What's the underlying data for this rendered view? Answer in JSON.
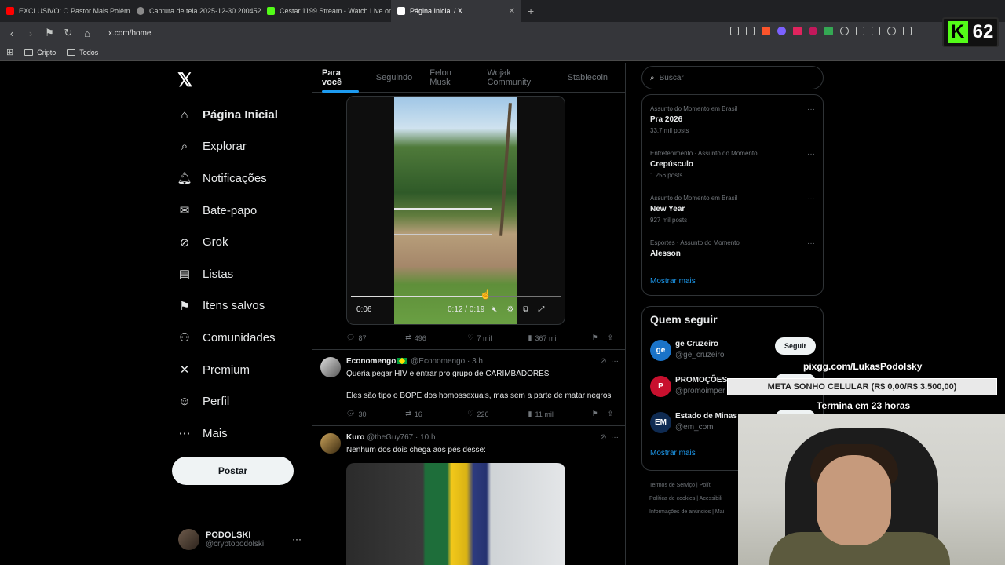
{
  "browser": {
    "tabs": [
      {
        "title": "EXCLUSIVO: O Pastor Mais Polêmico",
        "fav_color": "#ff0000",
        "active": false
      },
      {
        "title": "Captura de tela 2025-12-30 200452...",
        "fav_color": "#8a8a8a",
        "active": false
      },
      {
        "title": "Cestari1199 Stream - Watch Live on ...",
        "fav_color": "#53fc18",
        "active": false
      },
      {
        "title": "Página Inicial / X",
        "fav_color": "#ffffff",
        "active": true
      }
    ],
    "new_tab": "+",
    "close": "✕",
    "url": "x.com/home",
    "bookmarks": [
      "Cripto",
      "Todos"
    ]
  },
  "overlay_kick": {
    "logo": "K",
    "count": "62"
  },
  "x": {
    "logo": "𝕏",
    "nav": [
      {
        "label": "Página Inicial",
        "icon": "home-icon",
        "glyph": "⌂",
        "active": true
      },
      {
        "label": "Explorar",
        "icon": "search-icon",
        "glyph": "⌕"
      },
      {
        "label": "Notificações",
        "icon": "bell-icon",
        "glyph": "🔔︎"
      },
      {
        "label": "Bate-papo",
        "icon": "mail-icon",
        "glyph": "✉"
      },
      {
        "label": "Grok",
        "icon": "grok-icon",
        "glyph": "⊘"
      },
      {
        "label": "Listas",
        "icon": "list-icon",
        "glyph": "▤"
      },
      {
        "label": "Itens salvos",
        "icon": "bookmark-icon",
        "glyph": "⚑"
      },
      {
        "label": "Comunidades",
        "icon": "communities-icon",
        "glyph": "⚇"
      },
      {
        "label": "Premium",
        "icon": "x-premium-icon",
        "glyph": "✕"
      },
      {
        "label": "Perfil",
        "icon": "person-icon",
        "glyph": "☺"
      },
      {
        "label": "Mais",
        "icon": "more-circle-icon",
        "glyph": "⋯"
      }
    ],
    "post_button": "Postar",
    "account": {
      "name": "PODOLSKI",
      "handle": "@cryptopodolski",
      "more": "···"
    }
  },
  "feed": {
    "tabs": [
      "Para você",
      "Seguindo",
      "Felon Musk",
      "Wojak Community",
      "Stablecoin"
    ],
    "video": {
      "time_left": "0:06",
      "time": "0:12 / 0:19",
      "progress": 0.63
    },
    "post1_actions": {
      "replies": "87",
      "reposts": "496",
      "likes": "7 mil",
      "views": "367 mil"
    },
    "post2": {
      "name": "Economengo",
      "handle": "@Economengo · 3 h",
      "line1": "Queria pegar HIV e entrar pro grupo de CARIMBADORES",
      "line2": "Eles são tipo o BOPE dos homossexuais, mas sem a parte de matar negros",
      "actions": {
        "replies": "30",
        "reposts": "16",
        "likes": "226",
        "views": "11 mil"
      }
    },
    "post3": {
      "name": "Kuro",
      "handle": "@theGuy767 · 10 h",
      "line1": "Nenhum dos dois chega aos pés desse:"
    }
  },
  "sidebar": {
    "search_placeholder": "Buscar",
    "trends": [
      {
        "category": "Assunto do Momento em Brasil",
        "name": "Pra 2026",
        "count": "33,7 mil posts"
      },
      {
        "category": "Entretenimento · Assunto do Momento",
        "name": "Crepúsculo",
        "count": "1.256 posts"
      },
      {
        "category": "Assunto do Momento em Brasil",
        "name": "New Year",
        "count": "927 mil posts"
      },
      {
        "category": "Esportes · Assunto do Momento",
        "name": "Alesson",
        "count": ""
      }
    ],
    "show_more": "Mostrar mais",
    "who_to_follow": "Quem seguir",
    "follow_items": [
      {
        "name": "ge Cruzeiro",
        "handle": "@ge_cruzeiro",
        "avatar_text": "ge",
        "avatar_color": "#1a73c8"
      },
      {
        "name": "PROMOÇÕES",
        "handle": "@promoimper",
        "avatar_text": "P",
        "avatar_color": "#c8102e"
      },
      {
        "name": "Estado de Minas",
        "handle": "@em_com",
        "avatar_text": "EM",
        "avatar_color": "#0f2b52"
      }
    ],
    "follow_button": "Seguir",
    "footer": [
      "Termos de Serviço  |  Políti",
      "Política de cookies  |  Acessibili",
      "Informações de anúncios  |  Mai"
    ]
  },
  "stream_overlay": {
    "url": "pixgg.com/LukasPodolsky",
    "goal": "META SONHO CELULAR (R$ 0,00/R$ 3.500,00)",
    "ends": "Termina em 23 horas"
  }
}
